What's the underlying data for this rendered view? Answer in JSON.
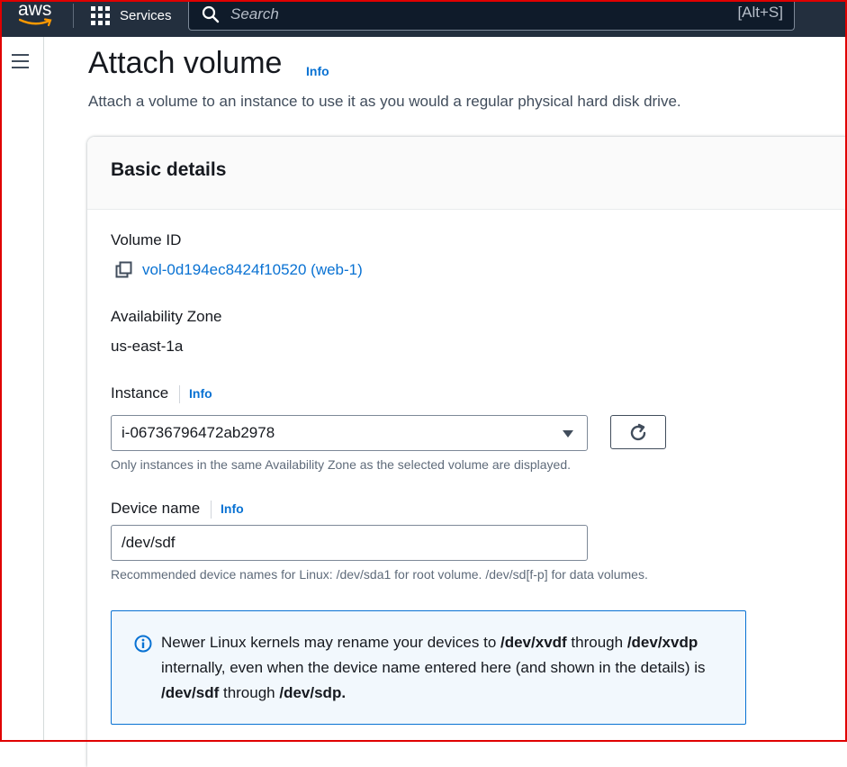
{
  "topbar": {
    "logo_text": "aws",
    "services_label": "Services",
    "search_placeholder": "Search",
    "search_shortcut": "[Alt+S]"
  },
  "page": {
    "title": "Attach volume",
    "title_info": "Info",
    "description": "Attach a volume to an instance to use it as you would a regular physical hard disk drive."
  },
  "basic_details": {
    "heading": "Basic details",
    "volume_id_label": "Volume ID",
    "volume_id_value": "vol-0d194ec8424f10520 (web-1)",
    "az_label": "Availability Zone",
    "az_value": "us-east-1a",
    "instance_label": "Instance",
    "instance_info": "Info",
    "instance_value": "i-06736796472ab2978",
    "instance_hint": "Only instances in the same Availability Zone as the selected volume are displayed.",
    "device_label": "Device name",
    "device_info": "Info",
    "device_value": "/dev/sdf",
    "device_hint": "Recommended device names for Linux: /dev/sda1 for root volume. /dev/sd[f-p] for data volumes."
  },
  "alert": {
    "part1": "Newer Linux kernels may rename your devices to ",
    "bold1": "/dev/xvdf",
    "part2": " through ",
    "bold2": "/dev/xvdp",
    "part3": " internally, even when the device name entered here (and shown in the details) is ",
    "bold3": "/dev/sdf",
    "part4": " through ",
    "bold4": "/dev/sdp."
  },
  "colors": {
    "topbar_bg": "#232f3e",
    "link": "#0972d3",
    "alert_border": "#0972d3",
    "alert_bg": "#f2f8fd",
    "frame_border": "#e00000"
  },
  "icons": [
    "aws-logo",
    "services-grid-icon",
    "search-icon",
    "hamburger-menu-icon",
    "copy-icon",
    "caret-down-icon",
    "refresh-icon",
    "info-circle-icon"
  ]
}
